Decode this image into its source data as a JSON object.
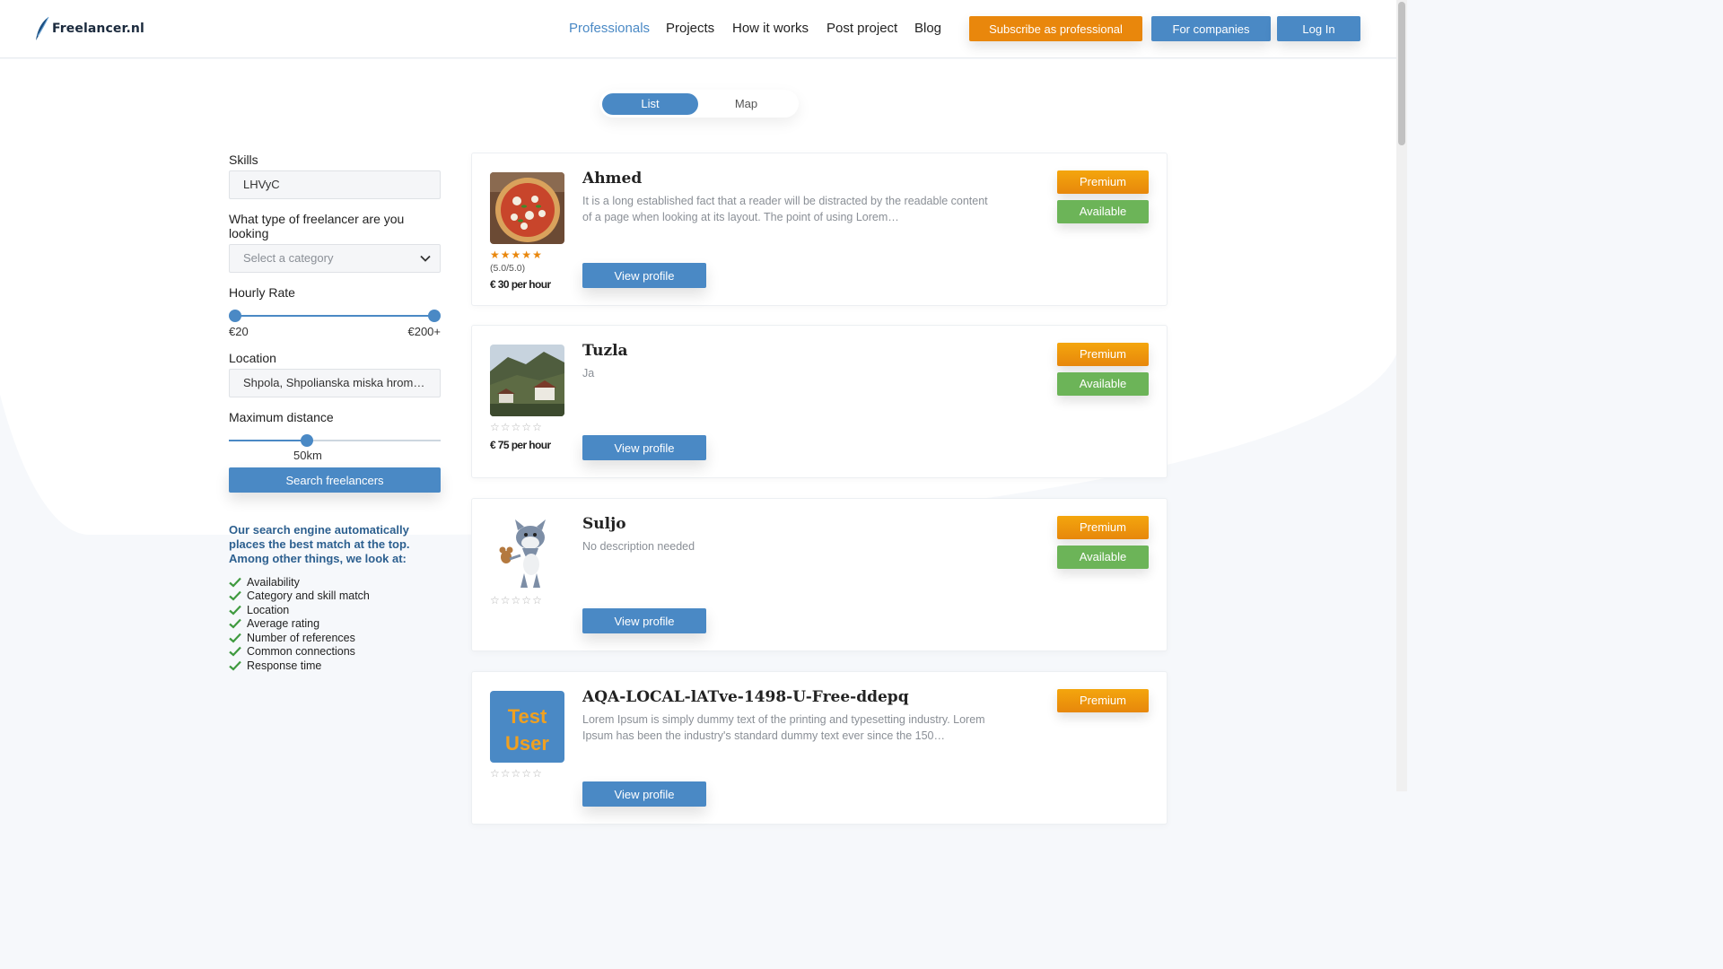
{
  "header": {
    "logo_text": "Freelancer.nl",
    "nav": [
      {
        "label": "Professionals",
        "active": true
      },
      {
        "label": "Projects",
        "active": false
      },
      {
        "label": "How it works",
        "active": false
      },
      {
        "label": "Post project",
        "active": false
      },
      {
        "label": "Blog",
        "active": false
      }
    ],
    "subscribe_label": "Subscribe as professional",
    "companies_label": "For companies",
    "login_label": "Log In"
  },
  "view_toggle": {
    "list_label": "List",
    "map_label": "Map",
    "selected": "List"
  },
  "filters": {
    "skills_label": "Skills",
    "skills_value": "LHVyC",
    "category_label": "What type of freelancer are you looking",
    "category_placeholder": "Select a category",
    "rate_label": "Hourly Rate",
    "rate_min": "€20",
    "rate_max": "€200+",
    "location_label": "Location",
    "location_value": "Shpola, Shpolianska miska hromada",
    "distance_label": "Maximum distance",
    "distance_value": "50km",
    "distance_fraction": 0.37,
    "search_label": "Search freelancers"
  },
  "info": {
    "title": "Our search engine automatically places the best match at the top. Among other things, we look at:",
    "items": [
      "Availability",
      "Category and skill match",
      "Location",
      "Average rating",
      "Number of references",
      "Common connections",
      "Response time"
    ]
  },
  "freelancers": [
    {
      "name": "Ahmed",
      "description": "It is a long established fact that a reader will be distracted by the readable content of a page when looking at its layout. The point of using Lorem…",
      "rating_value": 5,
      "rating_text": "(5.0/5.0)",
      "price": "€ 30 per hour",
      "view_label": "View profile",
      "premium_label": "Premium",
      "available_label": "Available",
      "photo": "pizza-photo"
    },
    {
      "name": "Tuzla",
      "description": "Ja",
      "rating_value": 0,
      "rating_text": "",
      "price": "€ 75 per hour",
      "view_label": "View profile",
      "premium_label": "Premium",
      "available_label": "Available",
      "photo": "landscape-photo"
    },
    {
      "name": "Suljo",
      "description": "No description needed",
      "rating_value": 0,
      "rating_text": "",
      "price": "",
      "view_label": "View profile",
      "premium_label": "Premium",
      "available_label": "Available",
      "photo": "cartoon-cat-photo"
    },
    {
      "name": "AQA-LOCAL-lATve-1498-U-Free-ddepq",
      "description": "Lorem Ipsum is simply dummy text of the printing and typesetting industry. Lorem Ipsum has been the industry's standard dummy text ever since the 150…",
      "rating_value": 0,
      "rating_text": "",
      "price": "",
      "view_label": "View profile",
      "premium_label": "Premium",
      "available_label": "",
      "photo": "test-user-photo",
      "photo_text_1": "Test",
      "photo_text_2": "User"
    }
  ],
  "colors": {
    "primary": "#4a89c5",
    "accent": "#e9870c",
    "available": "#6cb458",
    "star": "#e9870c"
  }
}
